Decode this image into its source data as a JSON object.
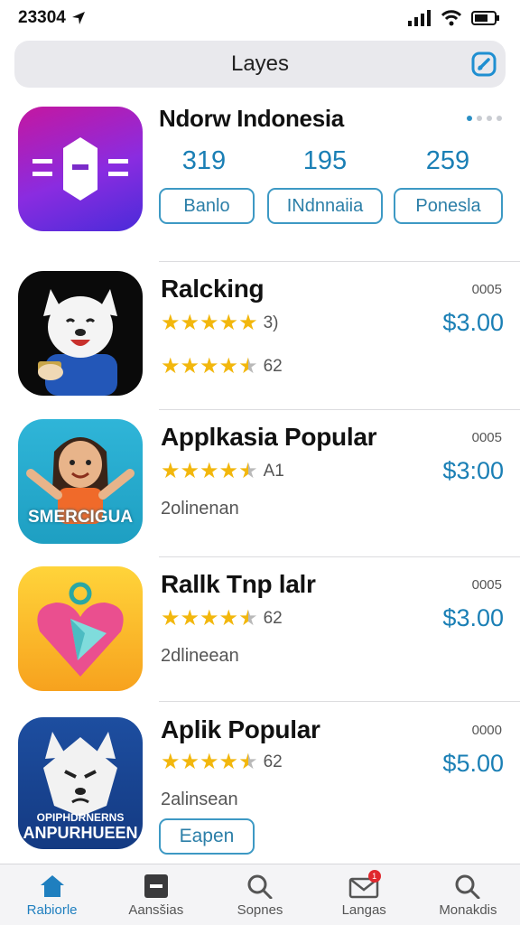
{
  "status_bar": {
    "time": "23304"
  },
  "search": {
    "title": "Layes"
  },
  "featured": {
    "title": "Ndorw Indonesia",
    "stats": [
      "319",
      "195",
      "259"
    ],
    "buttons": [
      "Banlo",
      "INdnnaiia",
      "Ponesla"
    ]
  },
  "apps": [
    {
      "title": "Ralcking",
      "meta": "0005",
      "price": "$3.00",
      "rating_1": 5,
      "rating_1_count": "3)",
      "rating_2": 4.5,
      "rating_2_count": "62"
    },
    {
      "title": "Applkasia Popular",
      "meta": "0005",
      "price": "$3:00",
      "rating_1": 4.5,
      "rating_1_count": "A1",
      "subtitle": "2olinenan",
      "icon_label": "SMERCIGUA"
    },
    {
      "title": "Rallk Tnp lalr",
      "meta": "0005",
      "price": "$3.00",
      "rating_1": 4.5,
      "rating_1_count": "62",
      "subtitle": "2dlineean"
    },
    {
      "title": "Aplik Popular",
      "meta": "0000",
      "price": "$5.00",
      "rating_1": 4.5,
      "rating_1_count": "62",
      "subtitle": "2alinsean",
      "button": "Eapen",
      "icon_label_1": "OPIPHDRNERNS",
      "icon_label_2": "ANPURHUEEN"
    }
  ],
  "tabs": [
    {
      "label": "Rabiorle",
      "icon": "home-icon",
      "active": true
    },
    {
      "label": "Aansšias",
      "icon": "minus-box-icon",
      "active": false
    },
    {
      "label": "Sopnes",
      "icon": "search-icon",
      "active": false
    },
    {
      "label": "Langas",
      "icon": "mail-icon",
      "active": false,
      "badge": "1"
    },
    {
      "label": "Monakdis",
      "icon": "search-icon",
      "active": false
    }
  ],
  "colors": {
    "accent": "#1a7fb5",
    "star": "#f2b70d",
    "badge": "#e0282e"
  }
}
